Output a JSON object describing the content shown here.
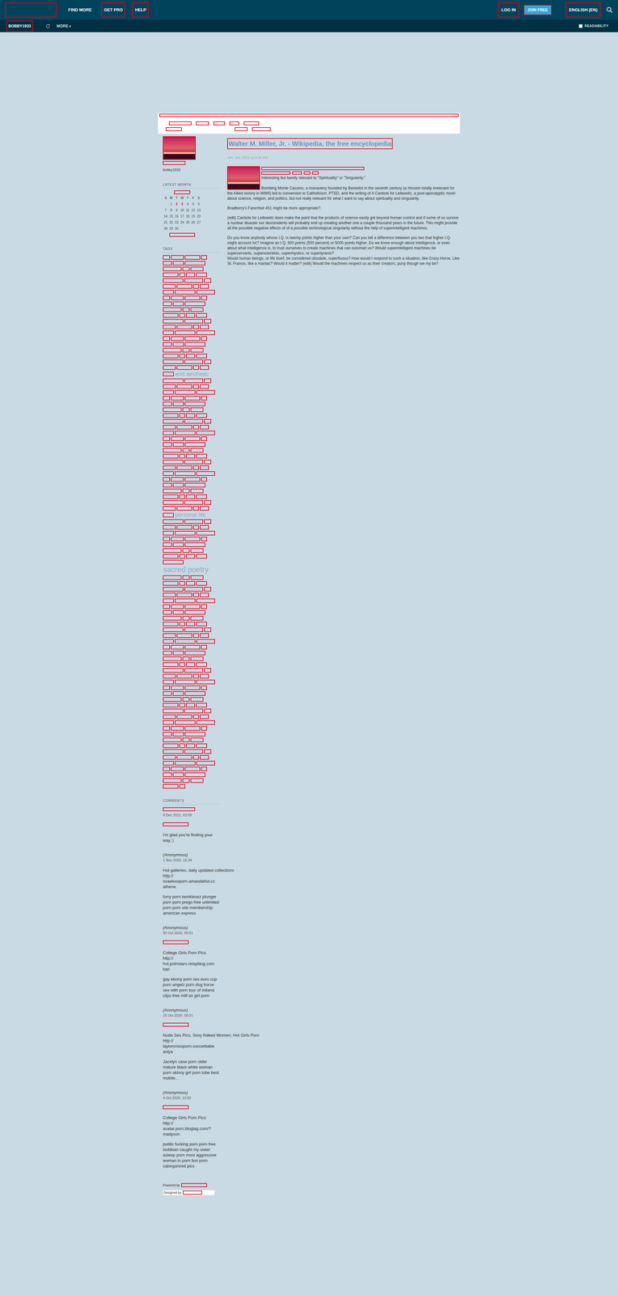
{
  "topbar": {
    "nav": [
      {
        "label": "FIND MORE",
        "marked": false
      },
      {
        "label": "GET PRO",
        "marked": true
      },
      {
        "label": "HELP",
        "marked": true
      }
    ],
    "login": {
      "label": "LOG IN",
      "marked": true
    },
    "join": {
      "label": "JOIN FREE",
      "marked": true
    },
    "language": {
      "label": "ENGLISH (EN)",
      "marked": true
    }
  },
  "subbar": {
    "user": "BOBBY1933",
    "more": "MORE",
    "more_caret": "▾",
    "readability": {
      "label": "READABILITY",
      "checked": false
    }
  },
  "post": {
    "title": "Walter M. Miller, Jr. - Wikipedia, the free encyclopedia",
    "date": "Jan. 3rd, 2015 at 4:35 AM",
    "lead": "Interesting but barely relevant to \"Spirituality\" or \"Singularity.\"",
    "paragraphs": [
      "Bombing Monte Cassino, a monastery founded by Benedict in the seventh century (a mission totally irrelevant for the Allied victory in WWII) led to conversion to Catholicism, PTSD, and the writing of A Canticle for Leibowitz, a post-apocalyptic novel about science, religion, and politics, but not really relevant for what I want to say about spirituality and singularity.",
      "Bradberry's Farenheit 451 might be more appropriate?.",
      "(edit) Canticle for Leibowitz does make the point that the products of science easily get beyond human control and if some  of us survive a nuclear disaster our descendents  will probably end up creating another one a couple thousand years in the future.  This might provide all the possible negative effects of of a possible technological singularity without the help of superintelligent machines.",
      "Do you know anybody whose I.Q. is twenty points higher than your own?  Can you tell a difference between you two that higher I.Q. might account for?  Imagine an I.Q. 500 points (500 percent) or 5000 points higher.  Do we know enough about intelligence, or even about what intelligence is, to trust ourselves to create machines that can outsmart us?  Would superintelligent machines be superservants, superscientists, supermystics, or supertyrants?\nWould human beings, or life itself, be considered obsolete, superfluous?  How would I respond to such a situation, like Crazy Horse, Like St. Francis, like a maniac?  Would it matter?  (edit) Would the machines respect us as their creators, puny though we my be?"
    ]
  },
  "sidebar": {
    "username": "bobby1933",
    "calendar": {
      "heading": "LATEST MONTH",
      "weekdays": [
        "S",
        "M",
        "T",
        "W",
        "T",
        "F",
        "S"
      ],
      "weeks": [
        [
          {
            "d": "",
            "linked": false
          },
          {
            "d": "1",
            "linked": false
          },
          {
            "d": "2",
            "linked": true
          },
          {
            "d": "3",
            "linked": true
          },
          {
            "d": "4",
            "linked": false
          },
          {
            "d": "5",
            "linked": false
          },
          {
            "d": "6",
            "linked": false
          }
        ],
        [
          {
            "d": "7",
            "linked": false
          },
          {
            "d": "8",
            "linked": false
          },
          {
            "d": "9",
            "linked": false
          },
          {
            "d": "10",
            "linked": false
          },
          {
            "d": "11",
            "linked": false
          },
          {
            "d": "12",
            "linked": false
          },
          {
            "d": "13",
            "linked": false
          }
        ],
        [
          {
            "d": "14",
            "linked": false
          },
          {
            "d": "15",
            "linked": false
          },
          {
            "d": "16",
            "linked": false
          },
          {
            "d": "17",
            "linked": false
          },
          {
            "d": "18",
            "linked": false
          },
          {
            "d": "19",
            "linked": false
          },
          {
            "d": "20",
            "linked": false
          }
        ],
        [
          {
            "d": "21",
            "linked": false
          },
          {
            "d": "22",
            "linked": false
          },
          {
            "d": "23",
            "linked": false
          },
          {
            "d": "24",
            "linked": false
          },
          {
            "d": "25",
            "linked": false
          },
          {
            "d": "26",
            "linked": false
          },
          {
            "d": "27",
            "linked": false
          }
        ],
        [
          {
            "d": "28",
            "linked": false
          },
          {
            "d": "29",
            "linked": false
          },
          {
            "d": "30",
            "linked": false
          }
        ]
      ]
    },
    "tags": {
      "heading": "TAGS",
      "redacted": 300,
      "visible": [
        {
          "text": "and aesthetic",
          "weight": 0.4,
          "at": 70
        },
        {
          "text": "personal life",
          "weight": 0.4,
          "at": 150
        },
        {
          "text": "sacred poetry",
          "weight": 0.8,
          "at": 175
        }
      ]
    },
    "comments": {
      "heading": "COMMENTS",
      "items": [
        {
          "author": "",
          "anonymous": false,
          "date": "6 Dec 2021, 03:09",
          "subject_redacted": true,
          "paragraphs": [
            [
              "I'm glad you're finding your way.:)"
            ]
          ]
        },
        {
          "author": "(Anonymous)",
          "anonymous": true,
          "date": "1 Nov 2020, 15:34",
          "subject_redacted": false,
          "paragraphs": [
            [
              "Hot galleries, daily updated collections",
              "http://",
              "israelxxxporn.amandahot.cc",
              "athena"
            ],
            [
              "furry porn twinklesez plunger porn porn prego free unlimited porn porn site membership american express"
            ]
          ]
        },
        {
          "author": "(Anonymous)",
          "anonymous": true,
          "date": "30 Oct 2020, 05:51",
          "subject_redacted": true,
          "paragraphs": [
            [
              "College Girls Porn Pics",
              "http://",
              "hot.potnstars.relayblog.com",
              "kari"
            ],
            [
              "gay ebony porn sex euro cup porn angelz porn dog horse sex with porn tour of ireland clips free milf on girl porn"
            ]
          ]
        },
        {
          "author": "(Anonymous)",
          "anonymous": true,
          "date": "15 Oct 2020, 08:31",
          "subject_redacted": true,
          "paragraphs": [
            [
              "Nude Sex Pics, Sexy Naked Women, Hot Girls Porn",
              "http://",
              "taylorcrossporn.soccerbabe",
              "aniya"
            ],
            [
              "Jacelyn case porn older mature black white woman porn skinny girl porn tube best mobile..."
            ]
          ]
        },
        {
          "author": "(Anonymous)",
          "anonymous": true,
          "date": "4 Oct 2020, 13:20",
          "subject_redacted": true,
          "paragraphs": [
            [
              "College Girls Porn Pics",
              "http://",
              "avatar.porn.bloglag.com/?",
              "madyson"
            ],
            [
              "public fucking porn porn free lesbbian caught my sieter asleep porn most aggressive woman in porn lion porn catorgorized pics"
            ]
          ]
        }
      ]
    },
    "footer": {
      "powered": "Powered by",
      "designed": "Designed by"
    }
  }
}
